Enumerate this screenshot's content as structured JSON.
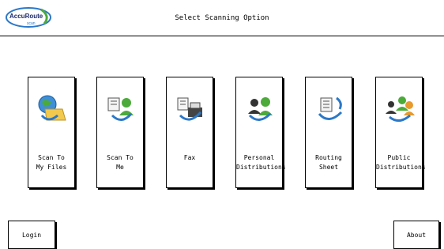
{
  "header": {
    "title": "Select Scanning Option",
    "logo_brand": "AccuRoute",
    "logo_sub": "scan"
  },
  "options": [
    {
      "line1": "Scan To",
      "line2": "My Files",
      "icon": "scan-to-my-files-icon"
    },
    {
      "line1": "Scan To",
      "line2": "Me",
      "icon": "scan-to-me-icon"
    },
    {
      "line1": "Fax",
      "line2": "",
      "icon": "fax-icon"
    },
    {
      "line1": "Personal",
      "line2": "Distributions",
      "icon": "personal-distributions-icon"
    },
    {
      "line1": "Routing",
      "line2": "Sheet",
      "icon": "routing-sheet-icon"
    },
    {
      "line1": "Public",
      "line2": "Distributions",
      "icon": "public-distributions-icon"
    }
  ],
  "footer": {
    "login_label": "Login",
    "about_label": "About"
  },
  "colors": {
    "accent_blue": "#2b78c8",
    "accent_green": "#4caa3a",
    "folder_yellow": "#f2c94c"
  }
}
